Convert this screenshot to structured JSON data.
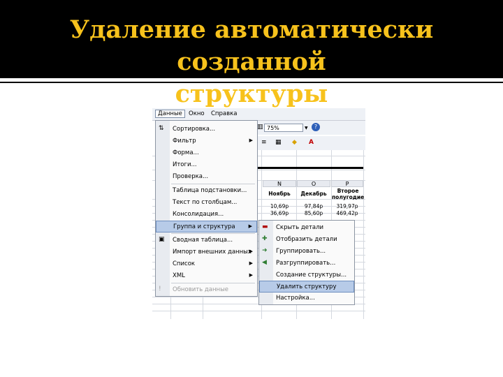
{
  "slide": {
    "title_line1": "Удаление автоматически созданной",
    "title_line2": "структуры"
  },
  "menubar": {
    "data": "Данные",
    "window": "Окно",
    "help": "Справка"
  },
  "toolbar": {
    "zoom": "75%"
  },
  "sheet": {
    "columns": [
      "N",
      "O",
      "P"
    ],
    "headers": [
      "Ноябрь",
      "Декабрь",
      "Второе полугодие"
    ],
    "row1": [
      "10,69р",
      "97,84р",
      "319,97р"
    ],
    "row2": [
      "36,69р",
      "85,60р",
      "469,42р"
    ]
  },
  "menu": {
    "items": [
      {
        "label": "Сортировка...",
        "icon": "sort-icon"
      },
      {
        "label": "Фильтр",
        "submenu": true
      },
      {
        "label": "Форма..."
      },
      {
        "label": "Итоги..."
      },
      {
        "label": "Проверка..."
      },
      {
        "label": "Таблица подстановки..."
      },
      {
        "label": "Текст по столбцам..."
      },
      {
        "label": "Консолидация..."
      },
      {
        "label": "Группа и структура",
        "submenu": true,
        "highlighted": true
      },
      {
        "label": "Сводная таблица...",
        "icon": "pivot-icon"
      },
      {
        "label": "Импорт внешних данных",
        "submenu": true
      },
      {
        "label": "Список",
        "submenu": true
      },
      {
        "label": "XML",
        "submenu": true
      },
      {
        "label": "Обновить данные",
        "disabled": true,
        "icon": "refresh-icon"
      }
    ]
  },
  "submenu": {
    "items": [
      {
        "label": "Скрыть детали",
        "icon": "hide-detail-icon"
      },
      {
        "label": "Отобразить детали",
        "icon": "show-detail-icon"
      },
      {
        "label": "Группировать...",
        "icon": "group-icon"
      },
      {
        "label": "Разгруппировать...",
        "icon": "ungroup-icon"
      },
      {
        "label": "Создание структуры..."
      },
      {
        "label": "Удалить структуру",
        "highlighted": true
      },
      {
        "label": "Настройка..."
      }
    ]
  },
  "colors": {
    "title": "#f7c21c",
    "title_bg": "#000000",
    "highlight": "#b7cbe8"
  }
}
